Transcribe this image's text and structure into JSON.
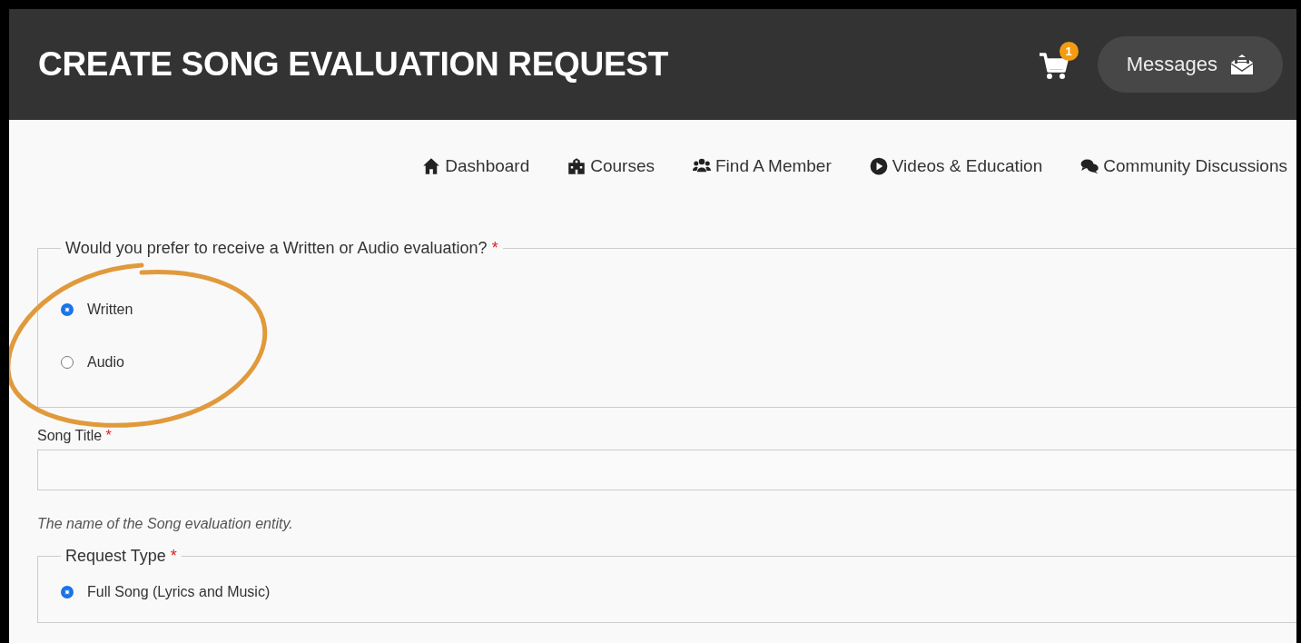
{
  "header": {
    "title": "CREATE SONG EVALUATION REQUEST",
    "cart_badge": "1",
    "messages_button": "Messages"
  },
  "nav": [
    {
      "label": "Dashboard"
    },
    {
      "label": "Courses"
    },
    {
      "label": "Find A Member"
    },
    {
      "label": "Videos & Education"
    },
    {
      "label": "Community Discussions"
    }
  ],
  "form": {
    "evaluation_type": {
      "legend": "Would you prefer to receive a Written or Audio evaluation?",
      "required_mark": "*",
      "options": [
        {
          "label": "Written",
          "selected": true
        },
        {
          "label": "Audio",
          "selected": false
        }
      ]
    },
    "song_title": {
      "label": "Song Title",
      "required_mark": "*",
      "help": "The name of the Song evaluation entity."
    },
    "request_type": {
      "legend": "Request Type",
      "required_mark": "*",
      "options": [
        {
          "label": "Full Song (Lyrics and Music)",
          "selected": true
        }
      ]
    }
  }
}
